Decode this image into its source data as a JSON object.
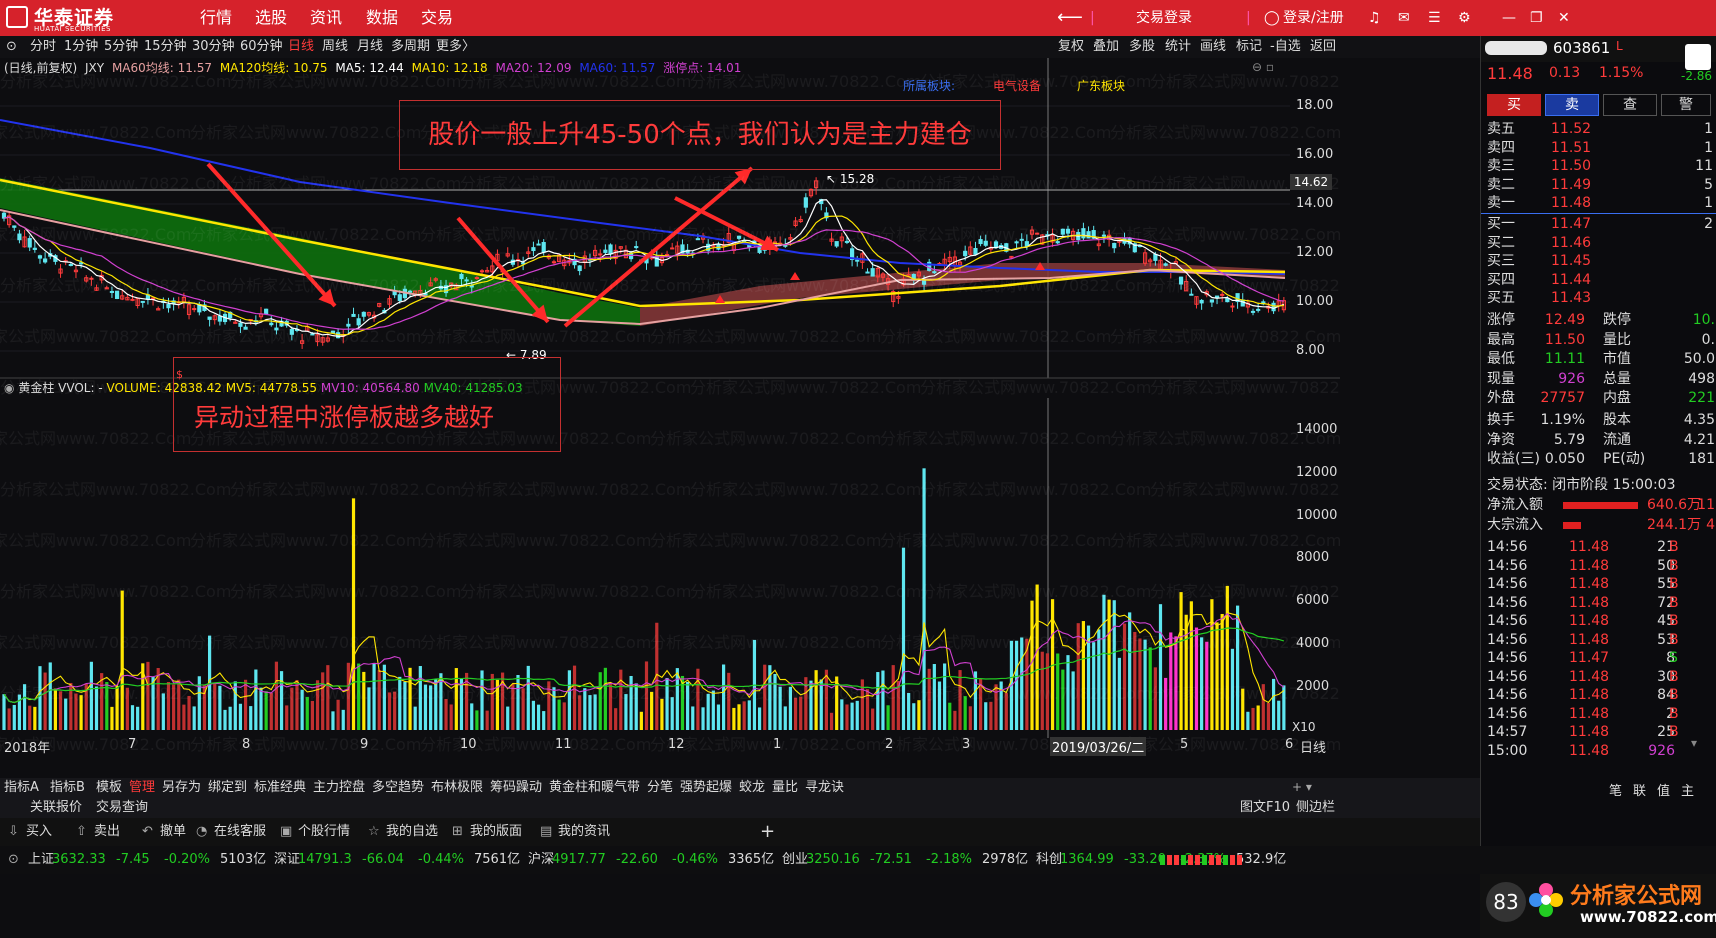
{
  "app": {
    "logo_cn": "华泰证券",
    "logo_en": "HUATAI SECURITIES",
    "menu": [
      "行情",
      "选股",
      "资讯",
      "数据",
      "交易"
    ],
    "trade_login": "交易登录",
    "user_login": "登录/注册"
  },
  "periods": [
    "分时",
    "1分钟",
    "5分钟",
    "15分钟",
    "30分钟",
    "60分钟",
    "日线",
    "周线",
    "月线",
    "多周期",
    "更多〉"
  ],
  "active_period": "日线",
  "chart_tools": [
    "复权",
    "叠加",
    "多股",
    "统计",
    "画线",
    "标记",
    "-自选",
    "返回"
  ],
  "stock": {
    "code": "603861",
    "price": "11.48",
    "change": "0.13",
    "pct": "1.15%",
    "side_change": "-2.86"
  },
  "ma_line": {
    "prefix": "(日线,前复权)",
    "jxy": "JXY",
    "ma60": "MA60均线: 11.57",
    "ma120": "MA120均线: 10.75",
    "ma5": "MA5: 12.44",
    "ma10": "MA10: 12.18",
    "ma20": "MA20: 12.09",
    "ma_hidden": "MA60: 11.57",
    "zt": "涨停点: 14.01"
  },
  "sectors": {
    "label": "所属板块:",
    "s1": "电气设备",
    "s2": "广东板块"
  },
  "price_axis": [
    "18.00",
    "16.00",
    "14.00",
    "12.00",
    "10.00",
    "8.00"
  ],
  "crosshair_price": "14.62",
  "high_marker": "15.28",
  "low_marker": "7.89",
  "vol_line": {
    "name": "黄金柱",
    "vvol": "VVOL: -",
    "volume": "VOLUME: 42838.42",
    "mv5": "MV5: 44778.55",
    "mv10": "MV10: 40564.80",
    "mv40": "MV40: 41285.03"
  },
  "vol_axis": [
    "14000",
    "12000",
    "10000",
    "8000",
    "6000",
    "4000",
    "2000"
  ],
  "vol_unit": "X10",
  "x_axis": [
    "2018年",
    "7",
    "8",
    "9",
    "10",
    "11",
    "12",
    "1",
    "2",
    "3",
    "2019/03/26/二",
    "5",
    "6"
  ],
  "x_axis_period": "日线",
  "annotations": {
    "top": "股价一般上升45-50个点，我们认为是主力建仓",
    "bottom": "异动过程中涨停板越多越好",
    "marker": "$"
  },
  "trade_buttons": [
    "买",
    "卖",
    "查",
    "警"
  ],
  "order_book": {
    "sells": [
      {
        "label": "卖五",
        "price": "11.52",
        "vol": "1"
      },
      {
        "label": "卖四",
        "price": "11.51",
        "vol": "1"
      },
      {
        "label": "卖三",
        "price": "11.50",
        "vol": "11"
      },
      {
        "label": "卖二",
        "price": "11.49",
        "vol": "5"
      },
      {
        "label": "卖一",
        "price": "11.48",
        "vol": "1"
      }
    ],
    "buys": [
      {
        "label": "买一",
        "price": "11.47",
        "vol": "2"
      },
      {
        "label": "买二",
        "price": "11.46",
        "vol": ""
      },
      {
        "label": "买三",
        "price": "11.45",
        "vol": ""
      },
      {
        "label": "买四",
        "price": "11.44",
        "vol": ""
      },
      {
        "label": "买五",
        "price": "11.43",
        "vol": ""
      }
    ]
  },
  "stats": [
    {
      "l": "涨停",
      "v": "12.49",
      "r": "跌停",
      "rv": "10.",
      "vc": "#ff3b3b",
      "rc": "#22cc22"
    },
    {
      "l": "最高",
      "v": "11.50",
      "r": "量比",
      "rv": "0.",
      "vc": "#ff3b3b",
      "rc": "#ddd"
    },
    {
      "l": "最低",
      "v": "11.11",
      "r": "市值",
      "rv": "50.0",
      "vc": "#22cc22",
      "rc": "#ddd"
    },
    {
      "l": "现量",
      "v": "926",
      "r": "总量",
      "rv": "498",
      "vc": "#d040d0",
      "rc": "#ddd"
    },
    {
      "l": "外盘",
      "v": "27757",
      "r": "内盘",
      "rv": "221",
      "vc": "#ff3b3b",
      "rc": "#22cc22"
    },
    {
      "l": "换手",
      "v": "1.19%",
      "r": "股本",
      "rv": "4.35",
      "vc": "#ddd",
      "rc": "#ddd"
    },
    {
      "l": "净资",
      "v": "5.79",
      "r": "流通",
      "rv": "4.21",
      "vc": "#ddd",
      "rc": "#ddd"
    },
    {
      "l": "收益(三)",
      "v": "0.050",
      "r": "PE(动)",
      "rv": "181",
      "vc": "#ddd",
      "rc": "#ddd"
    }
  ],
  "trade_state": "交易状态: 闭市阶段 15:00:03",
  "flows": [
    {
      "l": "净流入额",
      "v": "640.6万",
      "r": "11"
    },
    {
      "l": "大宗流入",
      "v": "244.1万",
      "r": "4"
    }
  ],
  "ticks": [
    {
      "t": "14:56",
      "p": "11.48",
      "v": "21",
      "s": "B"
    },
    {
      "t": "14:56",
      "p": "11.48",
      "v": "50",
      "s": "B"
    },
    {
      "t": "14:56",
      "p": "11.48",
      "v": "55",
      "s": "B"
    },
    {
      "t": "14:56",
      "p": "11.48",
      "v": "72",
      "s": "B"
    },
    {
      "t": "14:56",
      "p": "11.48",
      "v": "45",
      "s": "B"
    },
    {
      "t": "14:56",
      "p": "11.48",
      "v": "53",
      "s": "B"
    },
    {
      "t": "14:56",
      "p": "11.47",
      "v": "8",
      "s": "S"
    },
    {
      "t": "14:56",
      "p": "11.48",
      "v": "30",
      "s": "B"
    },
    {
      "t": "14:56",
      "p": "11.48",
      "v": "84",
      "s": "B"
    },
    {
      "t": "14:56",
      "p": "11.48",
      "v": "2",
      "s": "B"
    },
    {
      "t": "14:57",
      "p": "11.48",
      "v": "25",
      "s": "B"
    },
    {
      "t": "15:00",
      "p": "11.48",
      "v": "926",
      "s": ""
    }
  ],
  "right_tabs": [
    "笔",
    "联",
    "值",
    "主"
  ],
  "indicator_tabs": [
    "指标A",
    "指标B",
    "模板",
    "管理",
    "另存为",
    "绑定到",
    "标准经典",
    "主力控盘",
    "多空趋势",
    "布林极限",
    "筹码躁动",
    "黄金柱和暖气带",
    "分笔",
    "强势起爆",
    "蛟龙",
    "量比",
    "寻龙诀"
  ],
  "bottom_tabs2": [
    "关联报价",
    "交易查询",
    "图文F10",
    "侧边栏"
  ],
  "quick": [
    "买入",
    "卖出",
    "撤单",
    "在线客服",
    "个股行情",
    "我的自选",
    "我的版面",
    "我的资讯"
  ],
  "indices": [
    {
      "name": "上证",
      "val": "3632.33",
      "chg": "-7.45",
      "pct": "-0.20%",
      "amt": "5103亿"
    },
    {
      "name": "深证",
      "val": "14791.3",
      "chg": "-66.04",
      "pct": "-0.44%",
      "amt": "7561亿"
    },
    {
      "name": "沪深",
      "val": "4917.77",
      "chg": "-22.60",
      "pct": "-0.46%",
      "amt": "3365亿"
    },
    {
      "name": "创业",
      "val": "3250.16",
      "chg": "-72.51",
      "pct": "-2.18%",
      "amt": "2978亿"
    },
    {
      "name": "科创",
      "val": "1364.99",
      "chg": "-33.20",
      "pct": "-2.37%",
      "amt": "532.9亿"
    }
  ],
  "brand": {
    "name": "分析家公式网",
    "url": "www.70822.com",
    "num": "83"
  },
  "watermark": "分析家公式网www.70822.Com",
  "colors": {
    "red": "#ff3b3b",
    "green": "#22cc22",
    "yellow": "#ffe600",
    "cyan": "#5ee6f0",
    "blue": "#2233ee",
    "magenta": "#d040d0"
  }
}
